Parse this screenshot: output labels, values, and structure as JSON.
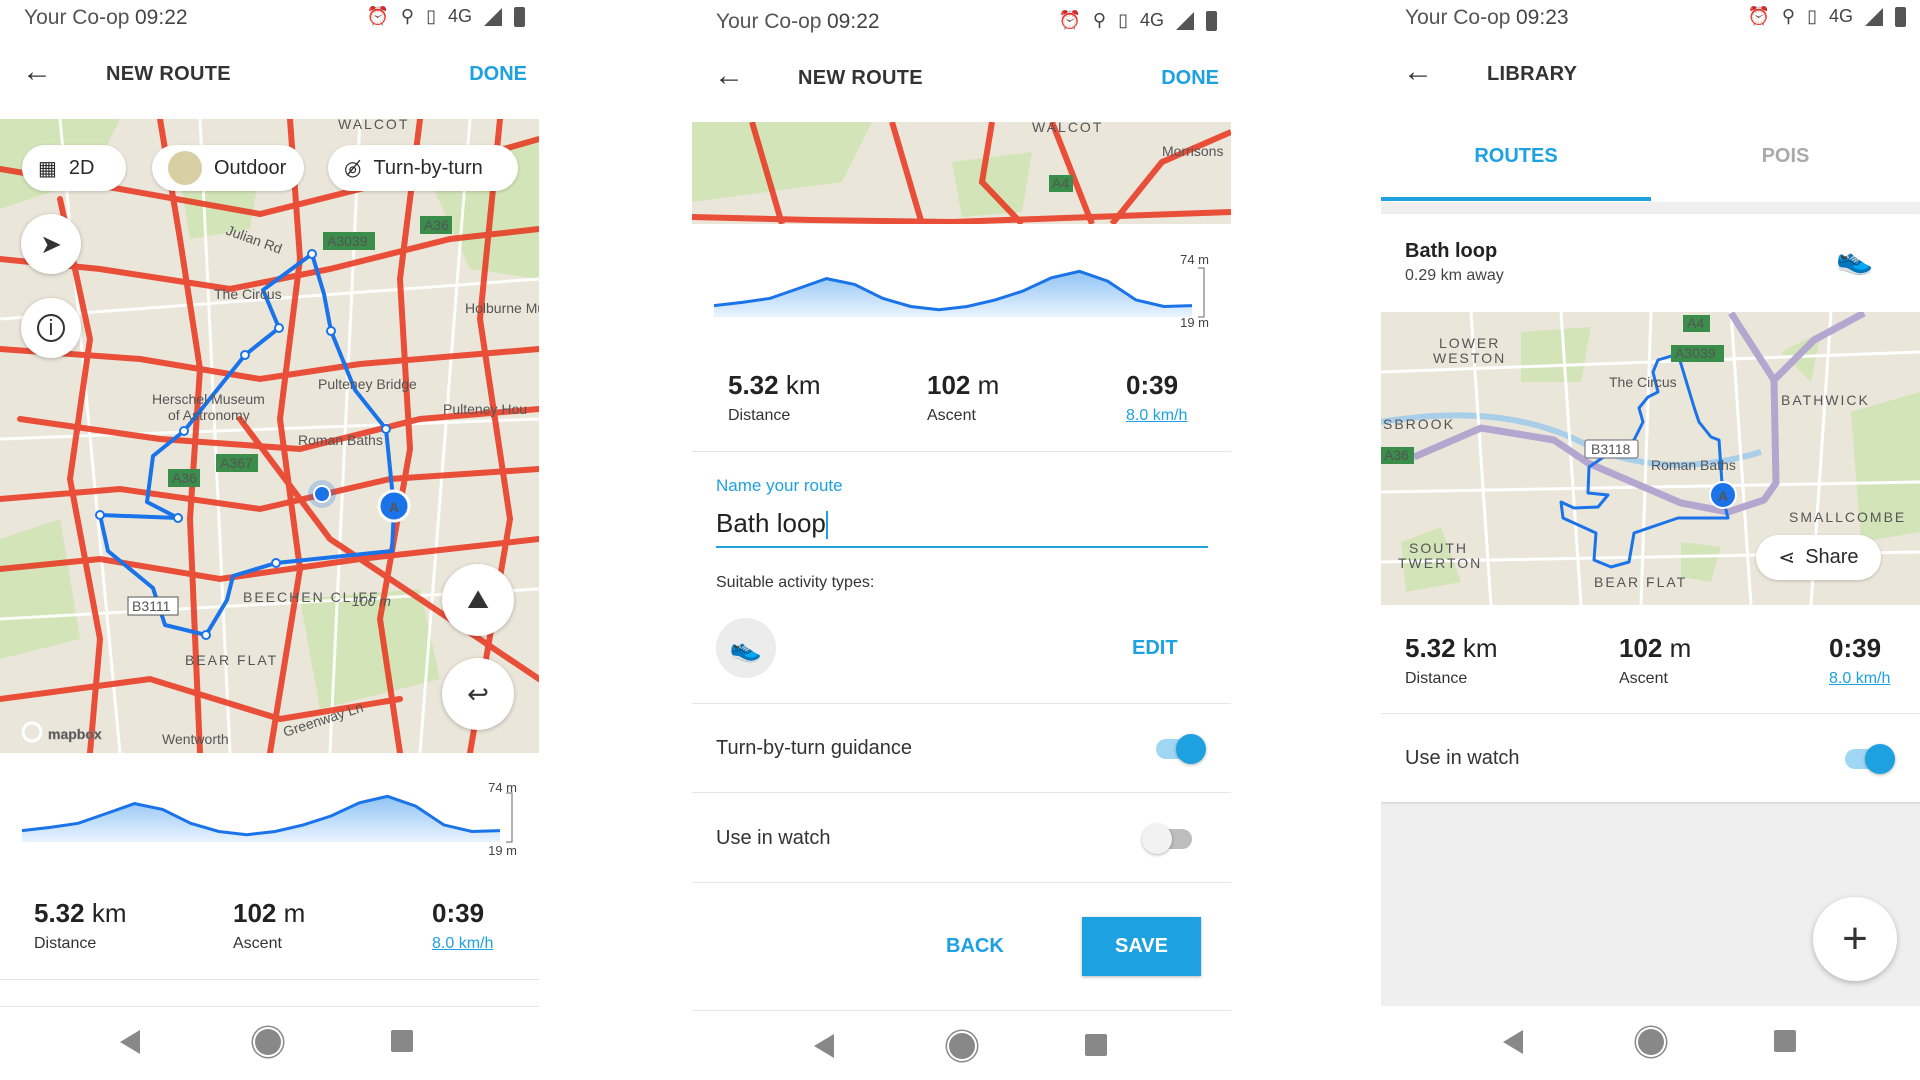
{
  "colors": {
    "accent": "#1da1e0",
    "route": "#1a73e8",
    "heat": "#e8341c",
    "map_bg": "#ebe6da"
  },
  "status_bars": [
    {
      "carrier": "Your Co-op",
      "time": "09:22",
      "network": "4G"
    },
    {
      "carrier": "Your Co-op",
      "time": "09:22",
      "network": "4G"
    },
    {
      "carrier": "Your Co-op",
      "time": "09:23",
      "network": "4G"
    }
  ],
  "route_stats": {
    "distance_value": "5.32",
    "distance_unit": "km",
    "distance_label": "Distance",
    "ascent_value": "102",
    "ascent_unit": "m",
    "ascent_label": "Ascent",
    "duration": "0:39",
    "speed": "8.0 km/h"
  },
  "elevation": {
    "max_label": "74 m",
    "min_label": "19 m",
    "min": 19,
    "max": 74,
    "profile_m": [
      28,
      32,
      37,
      49,
      61,
      54,
      37,
      27,
      23,
      27,
      35,
      46,
      62,
      70,
      58,
      35,
      27,
      28
    ]
  },
  "screen1": {
    "title": "NEW ROUTE",
    "done": "DONE",
    "chips": {
      "mode": "2D",
      "style": "Outdoor",
      "guidance": "Turn-by-turn"
    },
    "map_labels": {
      "walcot": "WALCOT",
      "julian": "Julian Rd",
      "a3039": "A3039",
      "a36": "A36",
      "circus": "The Circus",
      "holburne": "Holburne Museum",
      "pulteney": "Pulteney Bridge",
      "pulteney_hou": "Pulteney Hou",
      "herschel": "Herschel Museum",
      "astronomy": "of Astronomy",
      "roman": "Roman Baths",
      "a367": "A367",
      "a36b": "A36",
      "b3111": "B3111",
      "beechen": "BEECHEN CLIFF",
      "hundred": "100 m",
      "bear": "BEAR FLAT",
      "greenway": "Greenway Ln",
      "wentworth": "Wentworth",
      "mapbox": "mapbox",
      "marker": "A"
    }
  },
  "screen2": {
    "title": "NEW ROUTE",
    "done": "DONE",
    "map_labels": {
      "walcot": "WALCOT",
      "morrisons": "Morrisons",
      "a4": "A4"
    },
    "name_label": "Name your route",
    "name_value": "Bath loop",
    "activity_label": "Suitable activity types:",
    "edit": "EDIT",
    "turn_by_turn": {
      "label": "Turn-by-turn guidance",
      "on": true
    },
    "use_in_watch": {
      "label": "Use in watch",
      "on": false
    },
    "back": "BACK",
    "save": "SAVE"
  },
  "screen3": {
    "title": "LIBRARY",
    "tabs": [
      {
        "label": "ROUTES",
        "active": true
      },
      {
        "label": "POIS",
        "active": false
      }
    ],
    "route": {
      "name": "Bath loop",
      "distance_away": "0.29 km away",
      "activity_icon": "running-shoe-icon"
    },
    "map_labels": {
      "lower": "LOWER",
      "weston": "WESTON",
      "circus": "The Circus",
      "a4": "A4",
      "a3039": "A3039",
      "bathwick": "BATHWICK",
      "sbrook": "SBROOK",
      "a36": "A36",
      "b3118": "B3118",
      "roman": "Roman Baths",
      "south": "SOUTH",
      "twerton": "TWERTON",
      "bear": "BEAR FLAT",
      "smallcombe": "SMALLCOMBE",
      "marker": "A"
    },
    "share": "Share",
    "use_in_watch": {
      "label": "Use in watch",
      "on": true
    }
  }
}
